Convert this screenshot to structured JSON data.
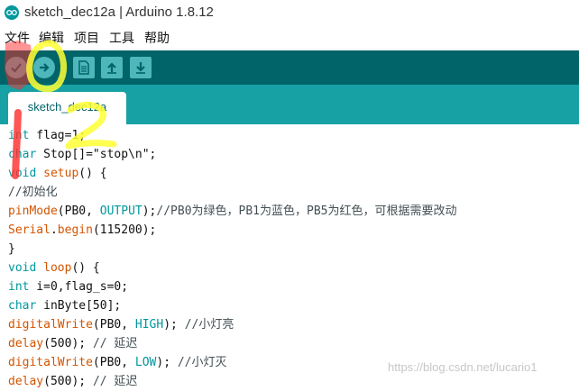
{
  "window": {
    "title": "sketch_dec12a | Arduino 1.8.12"
  },
  "menu": [
    {
      "label": "文件"
    },
    {
      "label": "编辑"
    },
    {
      "label": "项目"
    },
    {
      "label": "工具"
    },
    {
      "label": "帮助"
    }
  ],
  "toolbar": {
    "buttons": [
      {
        "icon": "check-icon"
      },
      {
        "icon": "arrow-right-icon"
      },
      {
        "icon": "new-file-icon"
      },
      {
        "icon": "open-arrow-up-icon"
      },
      {
        "icon": "save-arrow-down-icon"
      }
    ]
  },
  "tab": {
    "label": "sketch_dec12a"
  },
  "code": [
    [
      {
        "t": "int",
        "c": "kw"
      },
      {
        "t": " flag=1;",
        "c": ""
      }
    ],
    [
      {
        "t": "char",
        "c": "kw"
      },
      {
        "t": " Stop[]=\"stop\\n\";",
        "c": ""
      }
    ],
    [
      {
        "t": "void",
        "c": "kw"
      },
      {
        "t": " ",
        "c": ""
      },
      {
        "t": "setup",
        "c": "fn"
      },
      {
        "t": "() {",
        "c": ""
      }
    ],
    [
      {
        "t": "//初始化",
        "c": "cmt"
      }
    ],
    [
      {
        "t": "pinMode",
        "c": "fn"
      },
      {
        "t": "(PB0, ",
        "c": ""
      },
      {
        "t": "OUTPUT",
        "c": "cst"
      },
      {
        "t": ");",
        "c": ""
      },
      {
        "t": "//PB0为绿色，PB1为蓝色，PB5为红色，可根据需要改动",
        "c": "cmt"
      }
    ],
    [
      {
        "t": "Serial",
        "c": "fn"
      },
      {
        "t": ".",
        "c": ""
      },
      {
        "t": "begin",
        "c": "fn"
      },
      {
        "t": "(115200);",
        "c": ""
      }
    ],
    [
      {
        "t": "}",
        "c": ""
      }
    ],
    [
      {
        "t": "void",
        "c": "kw"
      },
      {
        "t": " ",
        "c": ""
      },
      {
        "t": "loop",
        "c": "fn"
      },
      {
        "t": "() {",
        "c": ""
      }
    ],
    [
      {
        "t": "int",
        "c": "kw"
      },
      {
        "t": " i=0,flag_s=0;",
        "c": ""
      }
    ],
    [
      {
        "t": "char",
        "c": "kw"
      },
      {
        "t": " inByte[50];",
        "c": ""
      }
    ],
    [
      {
        "t": "digitalWrite",
        "c": "fn"
      },
      {
        "t": "(PB0, ",
        "c": ""
      },
      {
        "t": "HIGH",
        "c": "cst"
      },
      {
        "t": "); ",
        "c": ""
      },
      {
        "t": "//小灯亮",
        "c": "cmt"
      }
    ],
    [
      {
        "t": "delay",
        "c": "fn"
      },
      {
        "t": "(500); ",
        "c": ""
      },
      {
        "t": "// 延迟",
        "c": "cmt"
      }
    ],
    [
      {
        "t": "digitalWrite",
        "c": "fn"
      },
      {
        "t": "(PB0, ",
        "c": ""
      },
      {
        "t": "LOW",
        "c": "cst"
      },
      {
        "t": "); ",
        "c": ""
      },
      {
        "t": "//小灯灭",
        "c": "cmt"
      }
    ],
    [
      {
        "t": "delay",
        "c": "fn"
      },
      {
        "t": "(500); ",
        "c": ""
      },
      {
        "t": "// 延迟",
        "c": "cmt"
      }
    ]
  ],
  "watermark": "https://blog.csdn.net/lucario1",
  "colors": {
    "toolbar": "#006468",
    "tab_strip": "#17a1a5",
    "button": "#4db7bb",
    "keyword": "#00979d",
    "function": "#d35400",
    "annotation_red": "#ff2a2a",
    "annotation_yellow": "#ffff33"
  }
}
